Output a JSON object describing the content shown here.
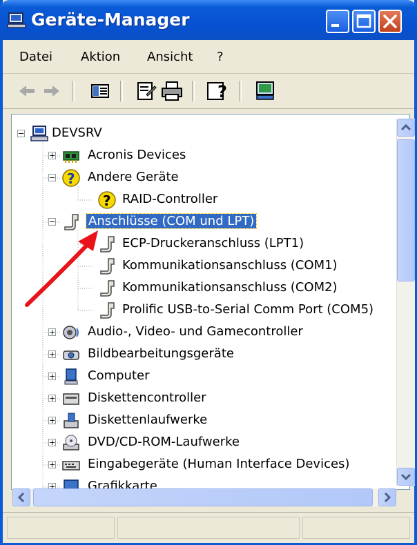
{
  "window": {
    "title": "Geräte-Manager"
  },
  "menu": [
    "Datei",
    "Aktion",
    "Ansicht",
    "?"
  ],
  "toolbar": {
    "buttons": [
      "back-arrow-icon",
      "forward-arrow-icon",
      "console-tree-icon",
      "properties-icon",
      "print-icon",
      "help-icon",
      "scan-hardware-icon"
    ]
  },
  "tree": {
    "root": "DEVSRV",
    "nodes": [
      {
        "label": "Acronis Devices",
        "expander": "+"
      },
      {
        "label": "Andere Geräte",
        "expander": "−"
      },
      {
        "label": "RAID-Controller"
      },
      {
        "label": "Anschlüsse (COM und LPT)",
        "expander": "−",
        "selected": true
      },
      {
        "label": "ECP-Druckeranschluss (LPT1)"
      },
      {
        "label": "Kommunikationsanschluss (COM1)"
      },
      {
        "label": "Kommunikationsanschluss (COM2)"
      },
      {
        "label": "Prolific USB-to-Serial Comm Port (COM5)"
      },
      {
        "label": "Audio-, Video- und Gamecontroller",
        "expander": "+"
      },
      {
        "label": "Bildbearbeitungsgeräte",
        "expander": "+"
      },
      {
        "label": "Computer",
        "expander": "+"
      },
      {
        "label": "Diskettencontroller",
        "expander": "+"
      },
      {
        "label": "Diskettenlaufwerke",
        "expander": "+"
      },
      {
        "label": "DVD/CD-ROM-Laufwerke",
        "expander": "+"
      },
      {
        "label": "Eingabegeräte (Human Interface Devices)",
        "expander": "+"
      },
      {
        "label": "Grafikkarte",
        "expander": "+"
      }
    ]
  },
  "colors": {
    "titlebar": "#0a5bd6",
    "selection": "#316ac5",
    "annotation_arrow": "#e8141a"
  }
}
